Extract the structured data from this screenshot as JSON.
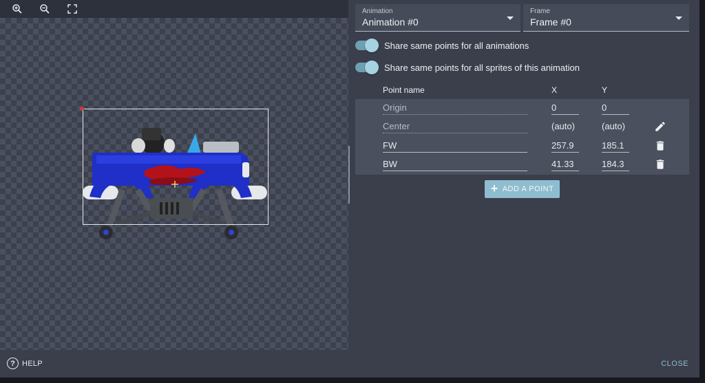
{
  "toolbar": {
    "zoom_in_icon": "zoom-in-icon",
    "zoom_out_icon": "zoom-out-icon",
    "fit_icon": "fullscreen-icon"
  },
  "animation_select": {
    "label": "Animation",
    "value": "Animation #0"
  },
  "frame_select": {
    "label": "Frame",
    "value": "Frame #0"
  },
  "toggles": [
    {
      "label": "Share same points for all animations",
      "checked": true
    },
    {
      "label": "Share same points for all sprites of this animation",
      "checked": true
    }
  ],
  "table": {
    "headers": {
      "name": "Point name",
      "x": "X",
      "y": "Y"
    },
    "rows": [
      {
        "name": "Origin",
        "x": "0",
        "y": "0",
        "action": ""
      },
      {
        "name": "Center",
        "x": "(auto)",
        "y": "(auto)",
        "action": "pencil-icon"
      },
      {
        "name": "FW",
        "x": "257.9",
        "y": "185.1",
        "action": "trash-icon"
      },
      {
        "name": "BW",
        "x": "41.33",
        "y": "184.3",
        "action": "trash-icon"
      }
    ]
  },
  "add_point_label": "ADD A POINT",
  "footer": {
    "help_label": "HELP",
    "close_label": "CLOSE"
  },
  "colors": {
    "accent": "#8fbdd0",
    "panel": "#3a3f4b",
    "rows_bg": "#4a505d"
  }
}
